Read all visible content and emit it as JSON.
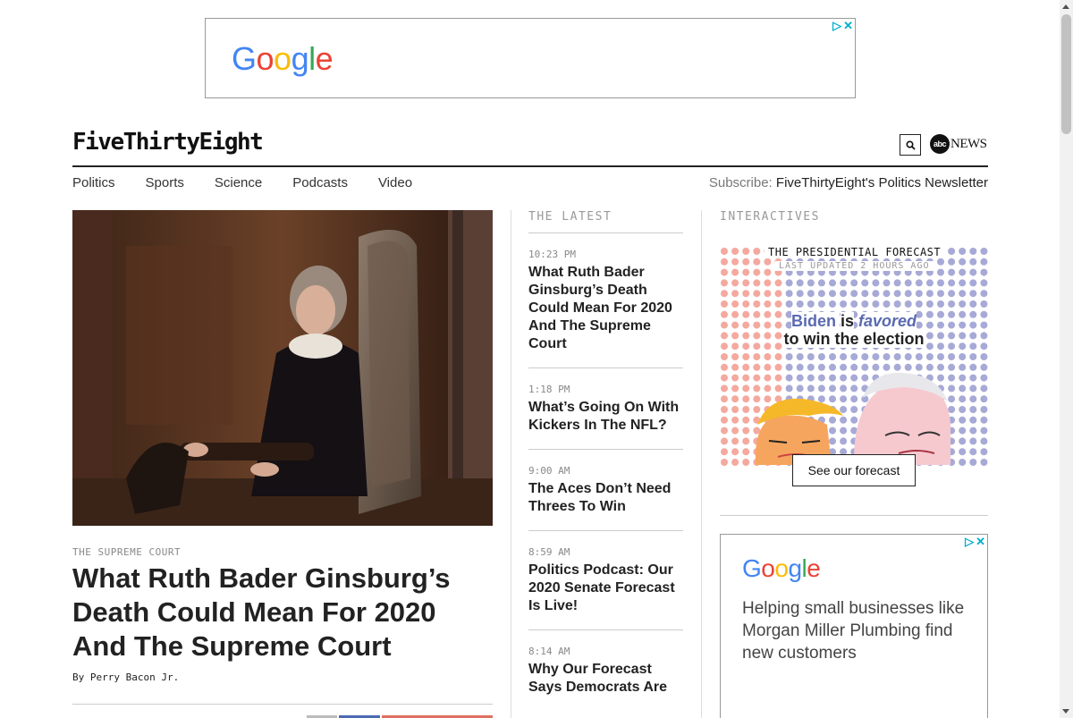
{
  "top_ad": {
    "brand": "Google"
  },
  "header": {
    "brand": "FiveThirtyEight",
    "partner": {
      "circle": "abc",
      "suffix": "NEWS"
    }
  },
  "nav": {
    "items": [
      "Politics",
      "Sports",
      "Science",
      "Podcasts",
      "Video"
    ],
    "subscribe_label": "Subscribe:",
    "subscribe_link": "FiveThirtyEight's Politics Newsletter"
  },
  "hero": {
    "kicker": "THE SUPREME COURT",
    "title": "What Ruth Bader Ginsburg’s Death Could Mean For 2020 And The Supreme Court",
    "byline": "By Perry Bacon Jr."
  },
  "latest": {
    "heading": "THE LATEST",
    "items": [
      {
        "time": "10:23 PM",
        "title": "What Ruth Bader Ginsburg’s Death Could Mean For 2020 And The Supreme Court"
      },
      {
        "time": "1:18 PM",
        "title": "What’s Going On With Kickers In The NFL?"
      },
      {
        "time": "9:00 AM",
        "title": "The Aces Don’t Need Threes To Win"
      },
      {
        "time": "8:59 AM",
        "title": "Politics Podcast: Our 2020 Senate Forecast Is Live!"
      },
      {
        "time": "8:14 AM",
        "title": "Why Our Forecast Says Democrats Are"
      }
    ]
  },
  "interactives": {
    "heading": "INTERACTIVES",
    "forecast": {
      "title": "THE PRESIDENTIAL FORECAST",
      "updated": "LAST UPDATED 2 HOURS AGO",
      "candidate": "Biden",
      "is": "is",
      "favored": "favored",
      "outcome": "to win the election",
      "button": "See our forecast",
      "colors": {
        "dem": "#a7a9d6",
        "rep": "#f4a99f"
      }
    }
  },
  "side_ad": {
    "brand": "Google",
    "text": "Helping small businesses like Morgan Miller Plumbing find new customers"
  }
}
